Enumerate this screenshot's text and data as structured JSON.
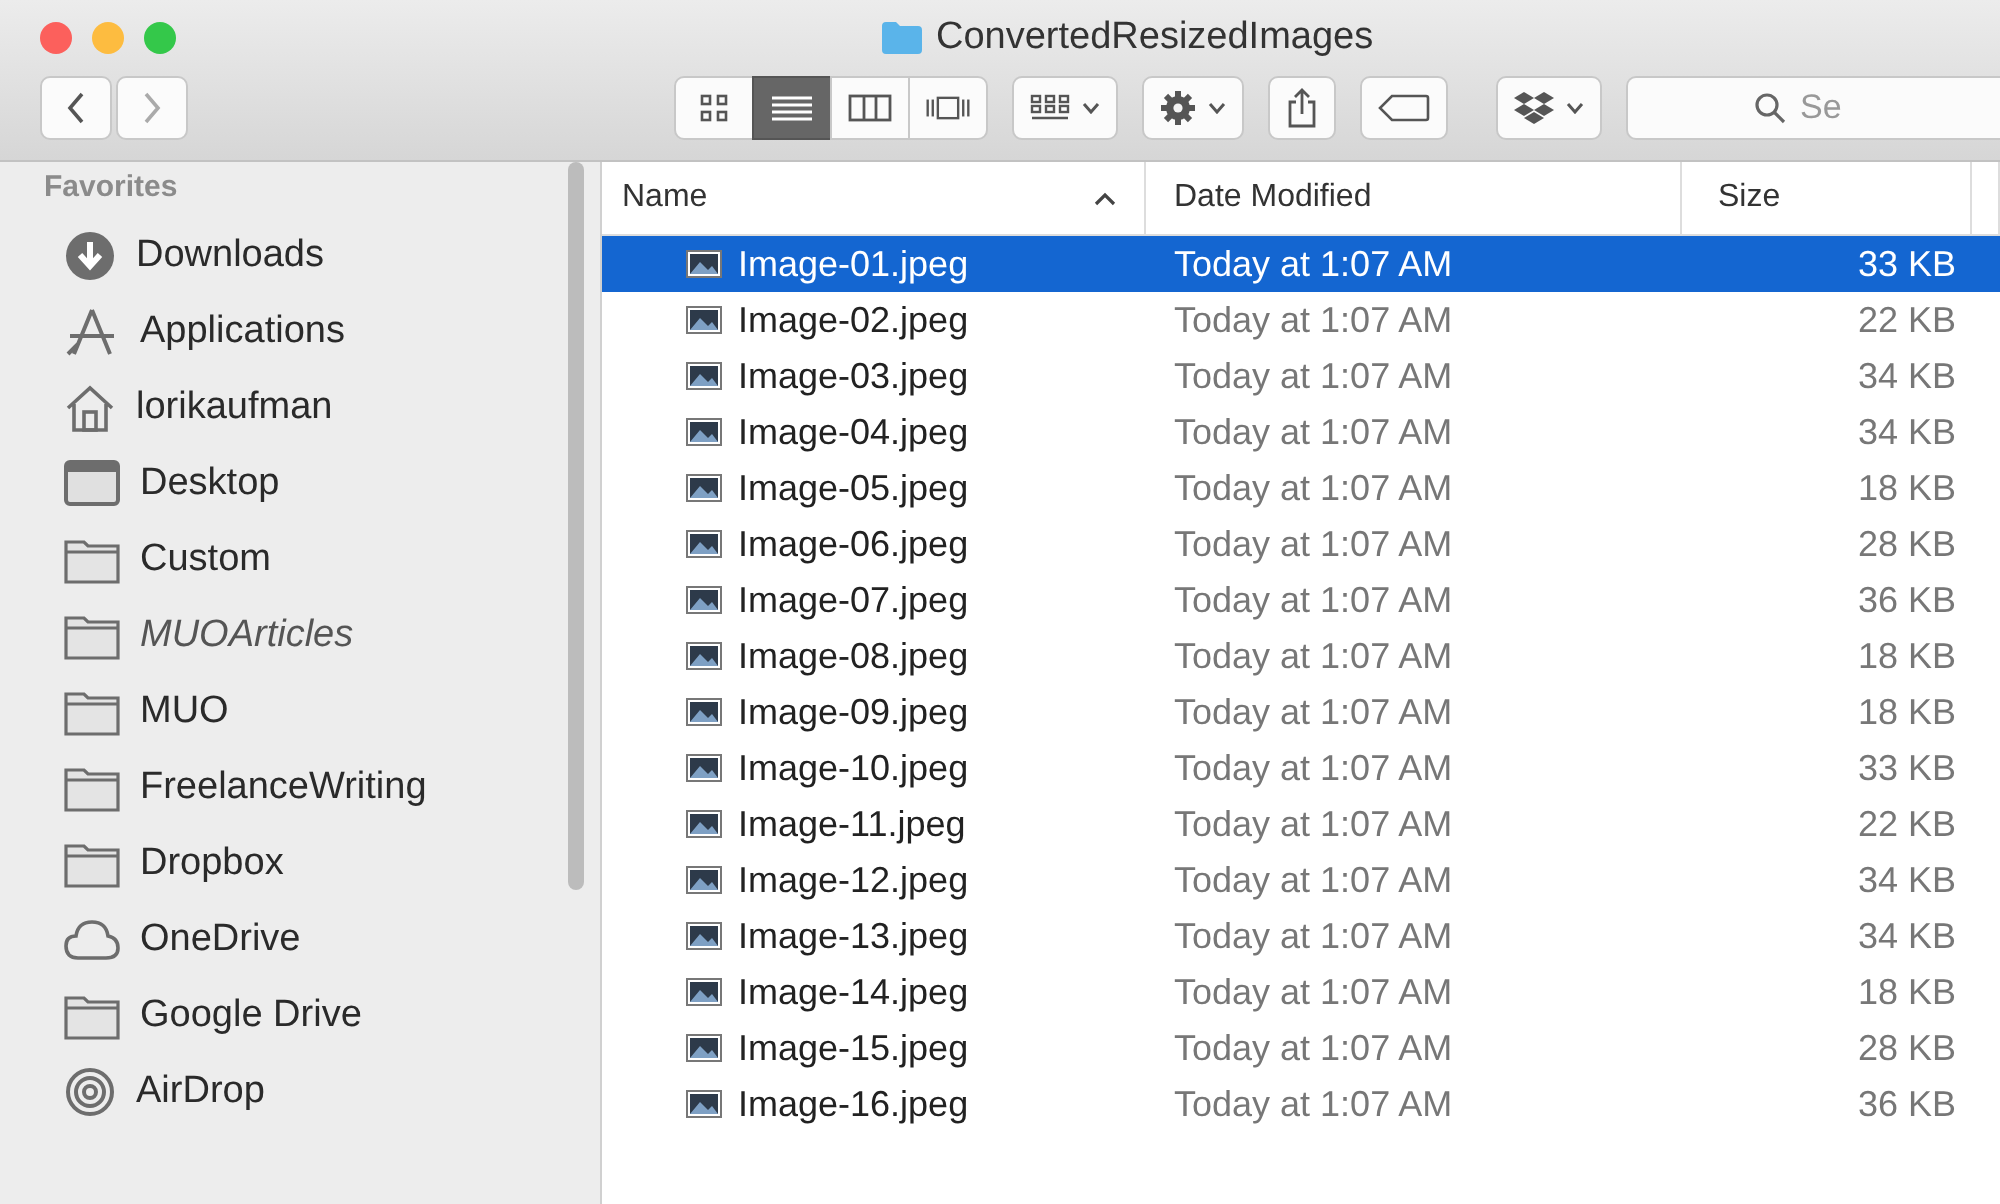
{
  "window": {
    "title": "ConvertedResizedImages"
  },
  "toolbar": {
    "view_modes": [
      {
        "kind": "icons",
        "selected": false
      },
      {
        "kind": "list",
        "selected": true
      },
      {
        "kind": "columns",
        "selected": false
      },
      {
        "kind": "gallery",
        "selected": false
      }
    ],
    "search": {
      "placeholder": "Se"
    }
  },
  "sidebar": {
    "heading": "Favorites",
    "items": [
      {
        "label": "Downloads",
        "kind": "downloads",
        "unavailable": false
      },
      {
        "label": "Applications",
        "kind": "applications",
        "unavailable": false
      },
      {
        "label": "lorikaufman",
        "kind": "home",
        "unavailable": false
      },
      {
        "label": "Desktop",
        "kind": "desktop",
        "unavailable": false
      },
      {
        "label": "Custom",
        "kind": "folder",
        "unavailable": false
      },
      {
        "label": "MUOArticles",
        "kind": "folder",
        "unavailable": true
      },
      {
        "label": "MUO",
        "kind": "folder",
        "unavailable": false
      },
      {
        "label": "FreelanceWriting",
        "kind": "folder",
        "unavailable": false
      },
      {
        "label": "Dropbox",
        "kind": "folder",
        "unavailable": false
      },
      {
        "label": "OneDrive",
        "kind": "cloud",
        "unavailable": false
      },
      {
        "label": "Google Drive",
        "kind": "folder",
        "unavailable": false
      },
      {
        "label": "AirDrop",
        "kind": "airdrop",
        "unavailable": false
      }
    ]
  },
  "table": {
    "columns": [
      "Name",
      "Date Modified",
      "Size"
    ],
    "rows": [
      {
        "name": "Image-01.jpeg",
        "date": "Today at 1:07 AM",
        "size": "33 KB",
        "selected": true
      },
      {
        "name": "Image-02.jpeg",
        "date": "Today at 1:07 AM",
        "size": "22 KB",
        "selected": false
      },
      {
        "name": "Image-03.jpeg",
        "date": "Today at 1:07 AM",
        "size": "34 KB",
        "selected": false
      },
      {
        "name": "Image-04.jpeg",
        "date": "Today at 1:07 AM",
        "size": "34 KB",
        "selected": false
      },
      {
        "name": "Image-05.jpeg",
        "date": "Today at 1:07 AM",
        "size": "18 KB",
        "selected": false
      },
      {
        "name": "Image-06.jpeg",
        "date": "Today at 1:07 AM",
        "size": "28 KB",
        "selected": false
      },
      {
        "name": "Image-07.jpeg",
        "date": "Today at 1:07 AM",
        "size": "36 KB",
        "selected": false
      },
      {
        "name": "Image-08.jpeg",
        "date": "Today at 1:07 AM",
        "size": "18 KB",
        "selected": false
      },
      {
        "name": "Image-09.jpeg",
        "date": "Today at 1:07 AM",
        "size": "18 KB",
        "selected": false
      },
      {
        "name": "Image-10.jpeg",
        "date": "Today at 1:07 AM",
        "size": "33 KB",
        "selected": false
      },
      {
        "name": "Image-11.jpeg",
        "date": "Today at 1:07 AM",
        "size": "22 KB",
        "selected": false
      },
      {
        "name": "Image-12.jpeg",
        "date": "Today at 1:07 AM",
        "size": "34 KB",
        "selected": false
      },
      {
        "name": "Image-13.jpeg",
        "date": "Today at 1:07 AM",
        "size": "34 KB",
        "selected": false
      },
      {
        "name": "Image-14.jpeg",
        "date": "Today at 1:07 AM",
        "size": "18 KB",
        "selected": false
      },
      {
        "name": "Image-15.jpeg",
        "date": "Today at 1:07 AM",
        "size": "28 KB",
        "selected": false
      },
      {
        "name": "Image-16.jpeg",
        "date": "Today at 1:07 AM",
        "size": "36 KB",
        "selected": false
      }
    ]
  }
}
